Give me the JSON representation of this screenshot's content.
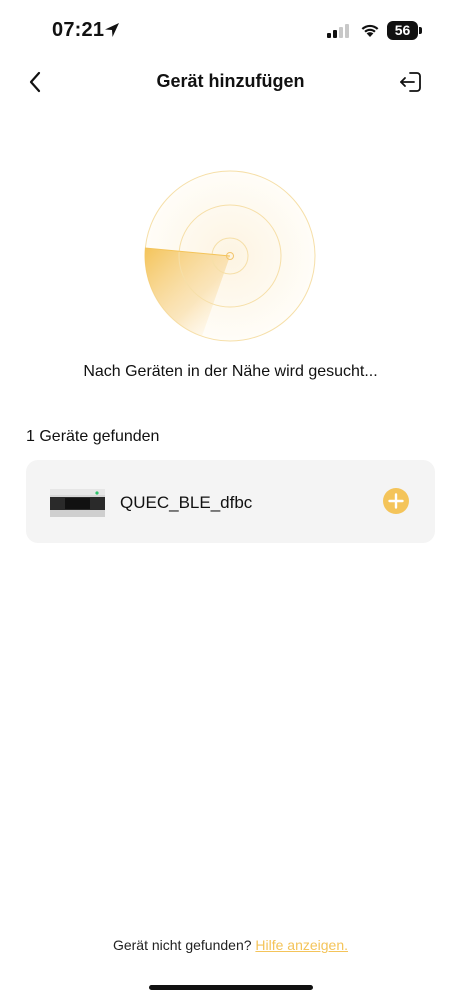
{
  "status_bar": {
    "time": "07:21",
    "battery": "56",
    "icons": [
      "location-arrow-icon",
      "cellular-signal-icon",
      "wifi-icon",
      "battery-icon"
    ]
  },
  "nav": {
    "title": "Gerät hinzufügen",
    "back_icon": "chevron-left-icon",
    "exit_icon": "exit-icon"
  },
  "scan": {
    "status_text": "Nach Geräten in der Nähe wird gesucht..."
  },
  "devices": {
    "found_label": "1 Geräte gefunden",
    "items": [
      {
        "name": "QUEC_BLE_dfbc",
        "icon": "device-image",
        "action_icon": "plus-circle-icon"
      }
    ]
  },
  "footer": {
    "question": "Gerät nicht gefunden?",
    "help_link": "Hilfe anzeigen."
  },
  "colors": {
    "accent": "#f4c45a",
    "card_background": "#f4f4f4",
    "text": "#111111"
  }
}
